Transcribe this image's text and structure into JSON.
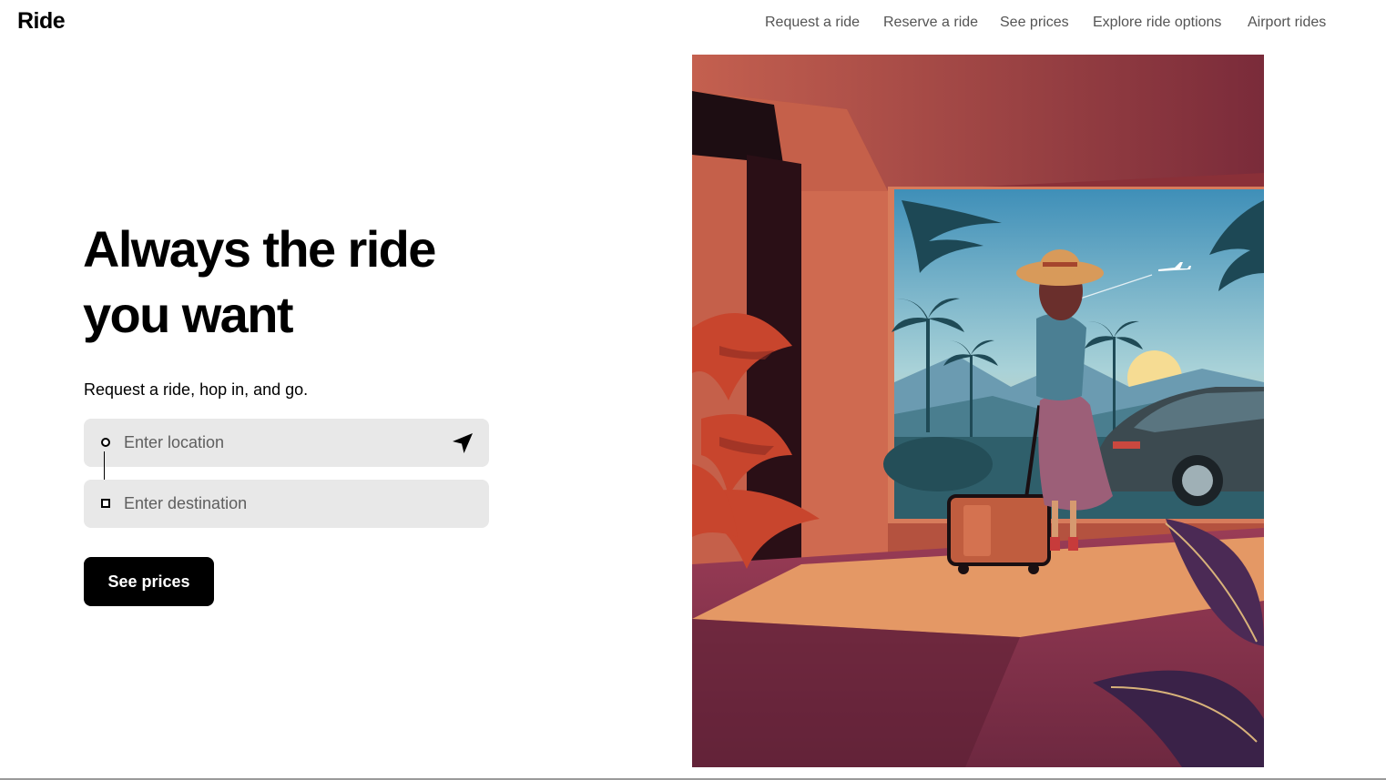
{
  "header": {
    "brand": "Ride",
    "nav": [
      "Request a ride",
      "Reserve a ride",
      "See prices",
      "Explore ride options",
      "Airport rides"
    ]
  },
  "hero": {
    "title_line1": "Always the ride",
    "title_line2": "you want",
    "subtitle": "Request a ride, hop in, and go."
  },
  "form": {
    "location_placeholder": "Enter location",
    "location_value": "",
    "destination_placeholder": "Enter destination",
    "destination_value": "",
    "locate_icon": "navigation-arrow-icon",
    "submit_label": "See prices"
  },
  "colors": {
    "button_bg": "#000000",
    "field_bg": "#e8e8e8",
    "nav_text": "#545454"
  }
}
